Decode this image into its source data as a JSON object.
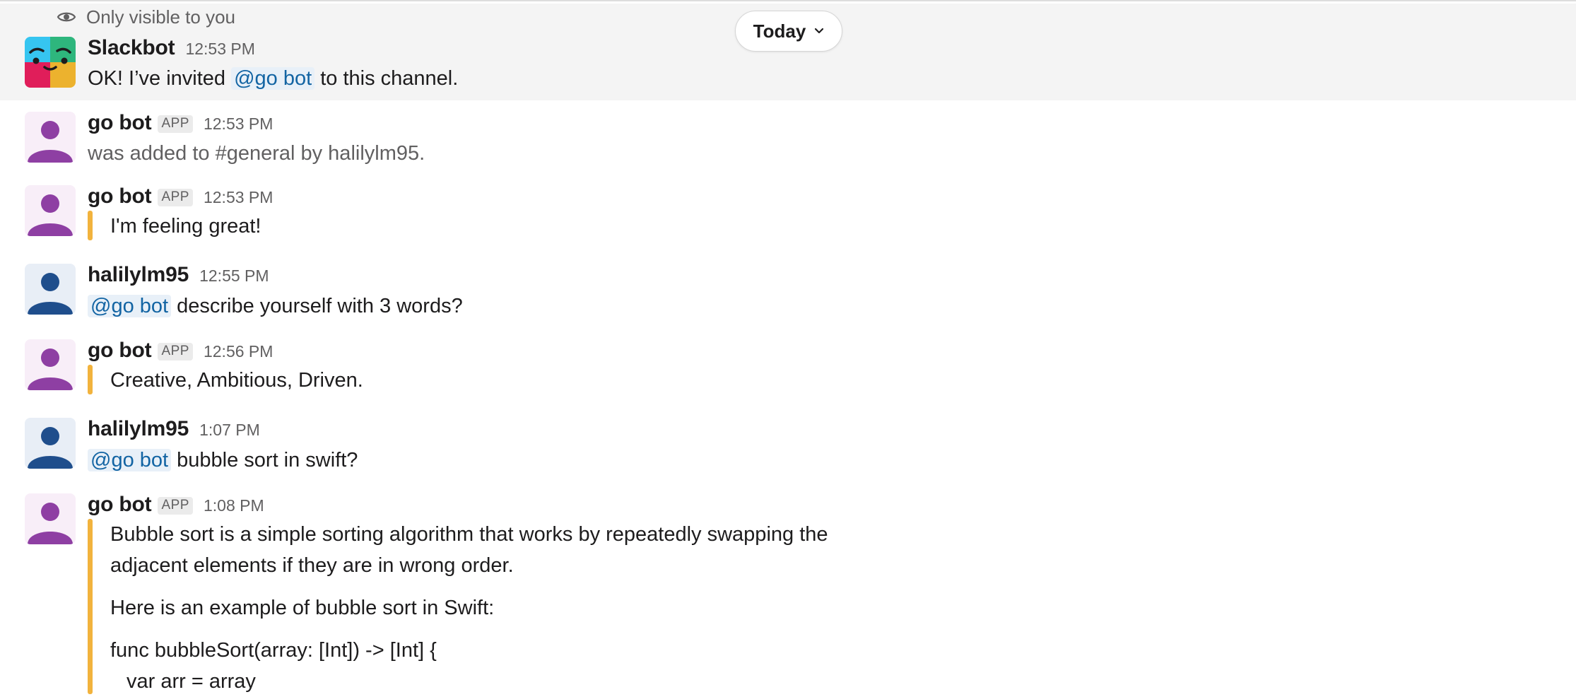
{
  "ephemeral_notice": {
    "label": "Only visible to you",
    "icon": "eye-icon"
  },
  "date_divider": {
    "label": "Today",
    "icon": "chevron-down-icon"
  },
  "colors": {
    "mention": "#1264a3",
    "mention_bg": "#e8f0f8",
    "quote_bar": "#f2b33d",
    "bot_avatar": "#8e3fa3",
    "user_avatar": "#1f4e8c",
    "highlight_bg": "#f4f4f4"
  },
  "messages": [
    {
      "sender": "Slackbot",
      "time": "12:53 PM",
      "text_before": "OK! I’ve invited ",
      "mention": "@go bot",
      "text_after": " to this channel."
    },
    {
      "sender": "go bot",
      "badge": "APP",
      "time": "12:53 PM",
      "text": "was added to #general by halilylm95."
    },
    {
      "sender": "go bot",
      "badge": "APP",
      "time": "12:53 PM",
      "text": "I'm feeling great!"
    },
    {
      "sender": "halilylm95",
      "time": "12:55 PM",
      "mention": "@go bot",
      "text_after": " describe yourself with 3 words?"
    },
    {
      "sender": "go bot",
      "badge": "APP",
      "time": "12:56 PM",
      "text": "Creative, Ambitious, Driven."
    },
    {
      "sender": "halilylm95",
      "time": "1:07 PM",
      "mention": "@go bot",
      "text_after": " bubble sort in swift?"
    },
    {
      "sender": "go bot",
      "badge": "APP",
      "time": "1:08 PM",
      "lines": [
        "Bubble sort is a simple sorting algorithm that works by repeatedly swapping the",
        "adjacent elements if they are in wrong order.",
        "Here is an example of bubble sort in Swift:",
        "func bubbleSort(array: [Int]) -> [Int] {",
        "var arr = array"
      ]
    }
  ]
}
